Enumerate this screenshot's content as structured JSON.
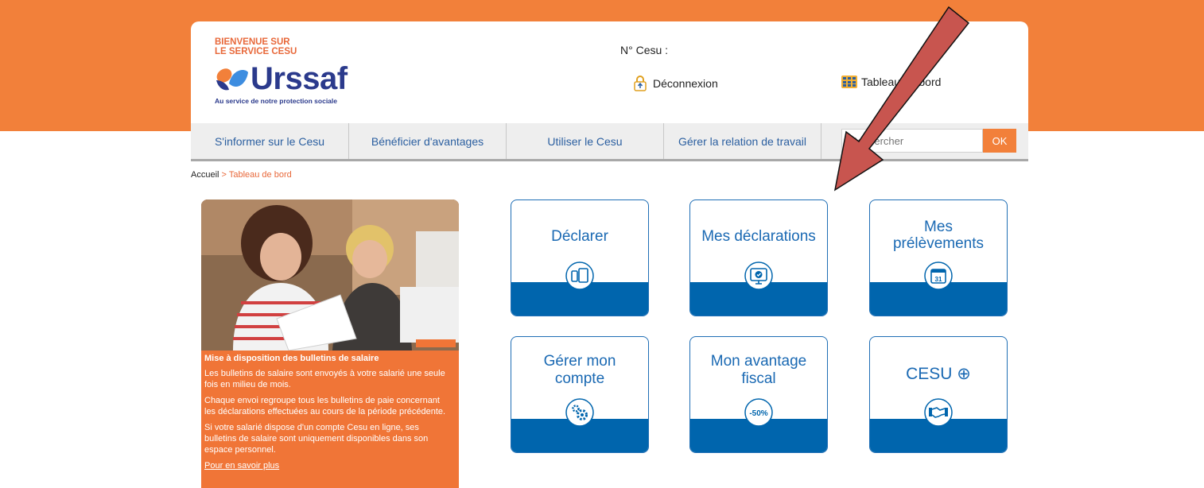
{
  "header": {
    "welcome_line1": "BIENVENUE SUR",
    "welcome_line2": "LE SERVICE CESU",
    "logo_text": "Urssaf",
    "logo_tagline": "Au service de notre protection sociale",
    "cesu_number_label": "N° Cesu :",
    "logout_label": "Déconnexion",
    "dashboard_label": "Tableau de bord"
  },
  "nav": {
    "items": [
      {
        "label": "S'informer sur le Cesu"
      },
      {
        "label": "Bénéficier d'avantages"
      },
      {
        "label": "Utiliser le Cesu"
      },
      {
        "label": "Gérer la relation de travail"
      }
    ],
    "search_placeholder": "Rechercher",
    "search_button": "OK"
  },
  "breadcrumb": {
    "home": "Accueil",
    "separator": ">",
    "current": "Tableau de bord"
  },
  "promo": {
    "title": "Mise à disposition des bulletins de salaire",
    "p1": "Les bulletins de salaire sont envoyés à votre salarié une seule fois en milieu de mois.",
    "p2": "Chaque envoi regroupe tous les bulletins de paie concernant les déclarations effectuées au cours de la période précédente.",
    "p3": "Si votre salarié dispose d'un compte Cesu en ligne, ses bulletins de salaire sont uniquement disponibles dans son espace personnel.",
    "link": "Pour en savoir plus"
  },
  "tiles": [
    {
      "line1": "Déclarer",
      "line2": "",
      "icon": "devices-icon"
    },
    {
      "line1": "Mes déclarations",
      "line2": "",
      "icon": "monitor-check-icon"
    },
    {
      "line1": "Mes",
      "line2": "prélèvements",
      "icon": "calendar-icon"
    },
    {
      "line1": "Gérer mon",
      "line2": "compte",
      "icon": "gears-icon"
    },
    {
      "line1": "Mon avantage",
      "line2": "fiscal",
      "icon": "discount-icon"
    },
    {
      "line1": "CESU ⊕",
      "line2": "",
      "icon": "handshake-icon"
    }
  ],
  "icon_text": {
    "calendar_day": "31",
    "discount": "-50%"
  },
  "colors": {
    "brand_orange": "#f2803a",
    "promo_orange": "#f07537",
    "tile_blue": "#0065ad",
    "urssaf_navy": "#2b3a8c",
    "annotation_arrow": "#c8554f"
  }
}
